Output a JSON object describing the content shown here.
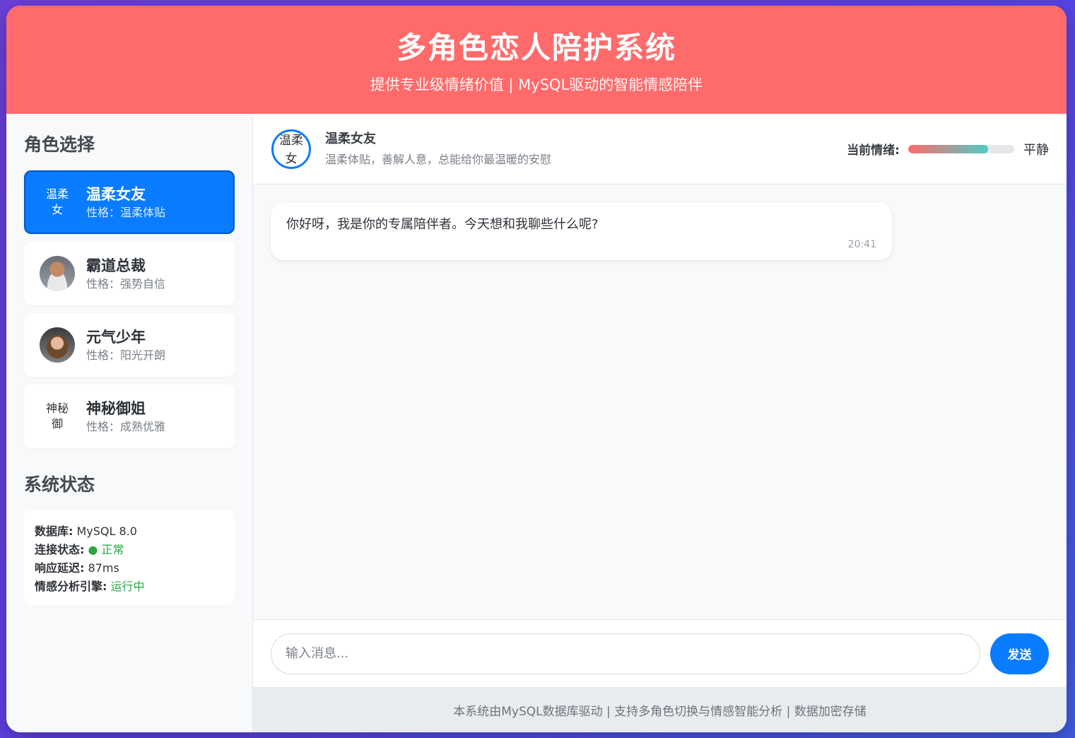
{
  "header": {
    "title": "多角色恋人陪护系统",
    "subtitle": "提供专业级情绪价值 | MySQL驱动的智能情感陪伴"
  },
  "sidebar": {
    "roles_title": "角色选择",
    "roles": [
      {
        "name": "温柔女友",
        "trait": "性格：温柔体贴",
        "avatar_alt": "温柔女",
        "active": true
      },
      {
        "name": "霸道总裁",
        "trait": "性格：强势自信",
        "avatar_alt": "",
        "active": false
      },
      {
        "name": "元气少年",
        "trait": "性格：阳光开朗",
        "avatar_alt": "",
        "active": false
      },
      {
        "name": "神秘御姐",
        "trait": "性格：成熟优雅",
        "avatar_alt": "神秘御",
        "active": false
      }
    ],
    "status_title": "系统状态",
    "status": {
      "db_label": "数据库:",
      "db_value": "MySQL 8.0",
      "conn_label": "连接状态:",
      "conn_value": "● 正常",
      "latency_label": "响应延迟:",
      "latency_value": "87ms",
      "engine_label": "情感分析引擎:",
      "engine_value": "运行中"
    }
  },
  "chat": {
    "role_name": "温柔女友",
    "role_desc": "温柔体贴，善解人意，总能给你最温暖的安慰",
    "avatar_alt": "温柔女",
    "mood_label": "当前情绪:",
    "mood_value": "平静",
    "mood_level": 0.75,
    "messages": [
      {
        "text": "你好呀，我是你的专属陪伴者。今天想和我聊些什么呢?",
        "time": "20:41"
      }
    ],
    "input_placeholder": "输入消息...",
    "send_label": "发送"
  },
  "footer": {
    "text": "本系统由MySQL数据库驱动 | 支持多角色切换与情感智能分析 | 数据加密存储"
  },
  "colors": {
    "header_bg": "#ff6b6b",
    "accent": "#0a7cff",
    "ok": "#28a745"
  }
}
